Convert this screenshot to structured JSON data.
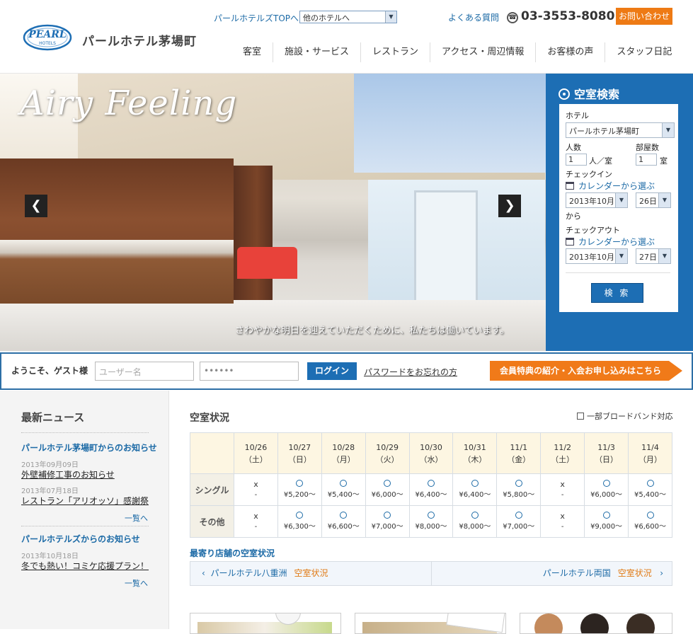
{
  "header": {
    "logo_text": "PEARL",
    "logo_sub": "HOTELS",
    "hotel_name": "パールホテル茅場町",
    "top_link": "パールホテルズTOPへ",
    "hotel_select": "他のホテルへ",
    "faq": "よくある質問",
    "phone": "03-3553-8080",
    "contact": "お問い合わせ",
    "nav": [
      "客室",
      "施設・サービス",
      "レストラン",
      "アクセス・周辺情報",
      "お客様の声",
      "スタッフ日記"
    ]
  },
  "hero": {
    "title": "Airy Feeling",
    "caption": "さわやかな明日を迎えていただくために、私たちは働いています。",
    "prev": "❮",
    "next": "❯"
  },
  "search": {
    "title": "空室検索",
    "hotel_label": "ホテル",
    "hotel_value": "パールホテル茅場町",
    "people_label": "人数",
    "people_value": "1",
    "people_unit": "人／室",
    "rooms_label": "部屋数",
    "rooms_value": "1",
    "rooms_unit": "室",
    "checkin_label": "チェックイン",
    "calendar_link": "カレンダーから選ぶ",
    "checkin_month": "2013年10月",
    "checkin_day": "26日",
    "from_label": "から",
    "checkout_label": "チェックアウト",
    "checkout_month": "2013年10月",
    "checkout_day": "27日",
    "button": "検 索"
  },
  "login": {
    "welcome": "ようこそ、ゲスト様",
    "user_placeholder": "ユーザー名",
    "pass_value": "••••••",
    "button": "ログイン",
    "forgot": "パスワードをお忘れの方",
    "member_banner": "会員特典の紹介・入会お申し込みはこちら"
  },
  "news": {
    "title": "最新ニュース",
    "groups": [
      {
        "head": "パールホテル茅場町からのお知らせ",
        "items": [
          {
            "date": "2013年09月09日",
            "title": "外壁補修工事のお知らせ"
          },
          {
            "date": "2013年07月18日",
            "title": "レストラン「アリオッソ」感謝祭"
          }
        ],
        "more": "一覧へ"
      },
      {
        "head": "パールホテルズからのお知らせ",
        "items": [
          {
            "date": "2013年10月18日",
            "title": "冬でも熱い！コミケ応援プラン！"
          }
        ],
        "more": "一覧へ"
      }
    ]
  },
  "vacancy": {
    "title": "空室状況",
    "broadband": "一部ブロードバンド対応",
    "dates": [
      {
        "d": "10/26",
        "w": "（土）"
      },
      {
        "d": "10/27",
        "w": "（日）"
      },
      {
        "d": "10/28",
        "w": "（月）"
      },
      {
        "d": "10/29",
        "w": "（火）"
      },
      {
        "d": "10/30",
        "w": "（水）"
      },
      {
        "d": "10/31",
        "w": "（木）"
      },
      {
        "d": "11/1",
        "w": "（金）"
      },
      {
        "d": "11/2",
        "w": "（土）"
      },
      {
        "d": "11/3",
        "w": "（日）"
      },
      {
        "d": "11/4",
        "w": "（月）"
      }
    ],
    "rows": [
      {
        "label": "シングル",
        "cells": [
          {
            "mark": "x",
            "price": "-"
          },
          {
            "mark": "o",
            "price": "¥5,200～"
          },
          {
            "mark": "o",
            "price": "¥5,400～"
          },
          {
            "mark": "o",
            "price": "¥6,000～"
          },
          {
            "mark": "o",
            "price": "¥6,400～"
          },
          {
            "mark": "o",
            "price": "¥6,400～"
          },
          {
            "mark": "o",
            "price": "¥5,800～"
          },
          {
            "mark": "x",
            "price": "-"
          },
          {
            "mark": "o",
            "price": "¥6,000～"
          },
          {
            "mark": "o",
            "price": "¥5,400～"
          }
        ]
      },
      {
        "label": "その他",
        "cells": [
          {
            "mark": "x",
            "price": "-"
          },
          {
            "mark": "o",
            "price": "¥6,300～"
          },
          {
            "mark": "o",
            "price": "¥6,600～"
          },
          {
            "mark": "o",
            "price": "¥7,000～"
          },
          {
            "mark": "o",
            "price": "¥8,000～"
          },
          {
            "mark": "o",
            "price": "¥8,000～"
          },
          {
            "mark": "o",
            "price": "¥7,000～"
          },
          {
            "mark": "x",
            "price": "-"
          },
          {
            "mark": "o",
            "price": "¥9,000～"
          },
          {
            "mark": "o",
            "price": "¥6,600～"
          }
        ]
      }
    ],
    "nearby_title": "最寄り店舗の空室状況",
    "nearby_left": "パールホテル八重洲",
    "nearby_right": "パールホテル両国",
    "vacancy_link": "空室状況"
  },
  "colors": {
    "brand_blue": "#1d6eb4",
    "accent_orange": "#ee7a14"
  }
}
